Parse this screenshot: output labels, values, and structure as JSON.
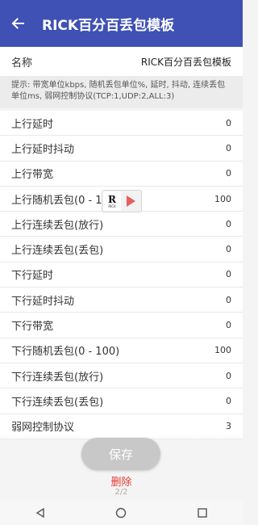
{
  "appbar": {
    "title": "RICK百分百丢包模板",
    "back_icon": "arrow-left-icon"
  },
  "name_row": {
    "label": "名称",
    "value": "RICK百分百丢包模板"
  },
  "hint": "提示: 带宽单位kbps, 随机丢包单位%, 延时, 抖动, 连续丢包单位ms, 弱网控制协议(TCP:1,UDP:2,ALL:3)",
  "rows": [
    {
      "label": "上行延时",
      "value": "0"
    },
    {
      "label": "上行延时抖动",
      "value": "0"
    },
    {
      "label": "上行带宽",
      "value": "0"
    },
    {
      "label": "上行随机丢包(0 - 1",
      "value": "100"
    },
    {
      "label": "上行连续丢包(放行)",
      "value": "0"
    },
    {
      "label": "上行连续丢包(丢包)",
      "value": "0"
    },
    {
      "label": "下行延时",
      "value": "0"
    },
    {
      "label": "下行延时抖动",
      "value": "0"
    },
    {
      "label": "下行带宽",
      "value": "0"
    },
    {
      "label": "下行随机丢包(0 - 100)",
      "value": "100"
    },
    {
      "label": "下行连续丢包(放行)",
      "value": "0"
    },
    {
      "label": "下行连续丢包(丢包)",
      "value": "0"
    },
    {
      "label": "弱网控制协议",
      "value": "3"
    }
  ],
  "overlay": {
    "logo_letter": "R",
    "logo_caption": "RICK",
    "icon": "play-icon"
  },
  "actions": {
    "save_label": "保存",
    "delete_label": "删除",
    "page_indicator": "2/2"
  },
  "navbar": {
    "back_icon": "nav-back-icon",
    "home_icon": "nav-home-icon",
    "recents_icon": "nav-recents-icon"
  },
  "colors": {
    "appbar": "#3f51b5",
    "delete": "#e53935",
    "overlay_play": "#e26060"
  }
}
